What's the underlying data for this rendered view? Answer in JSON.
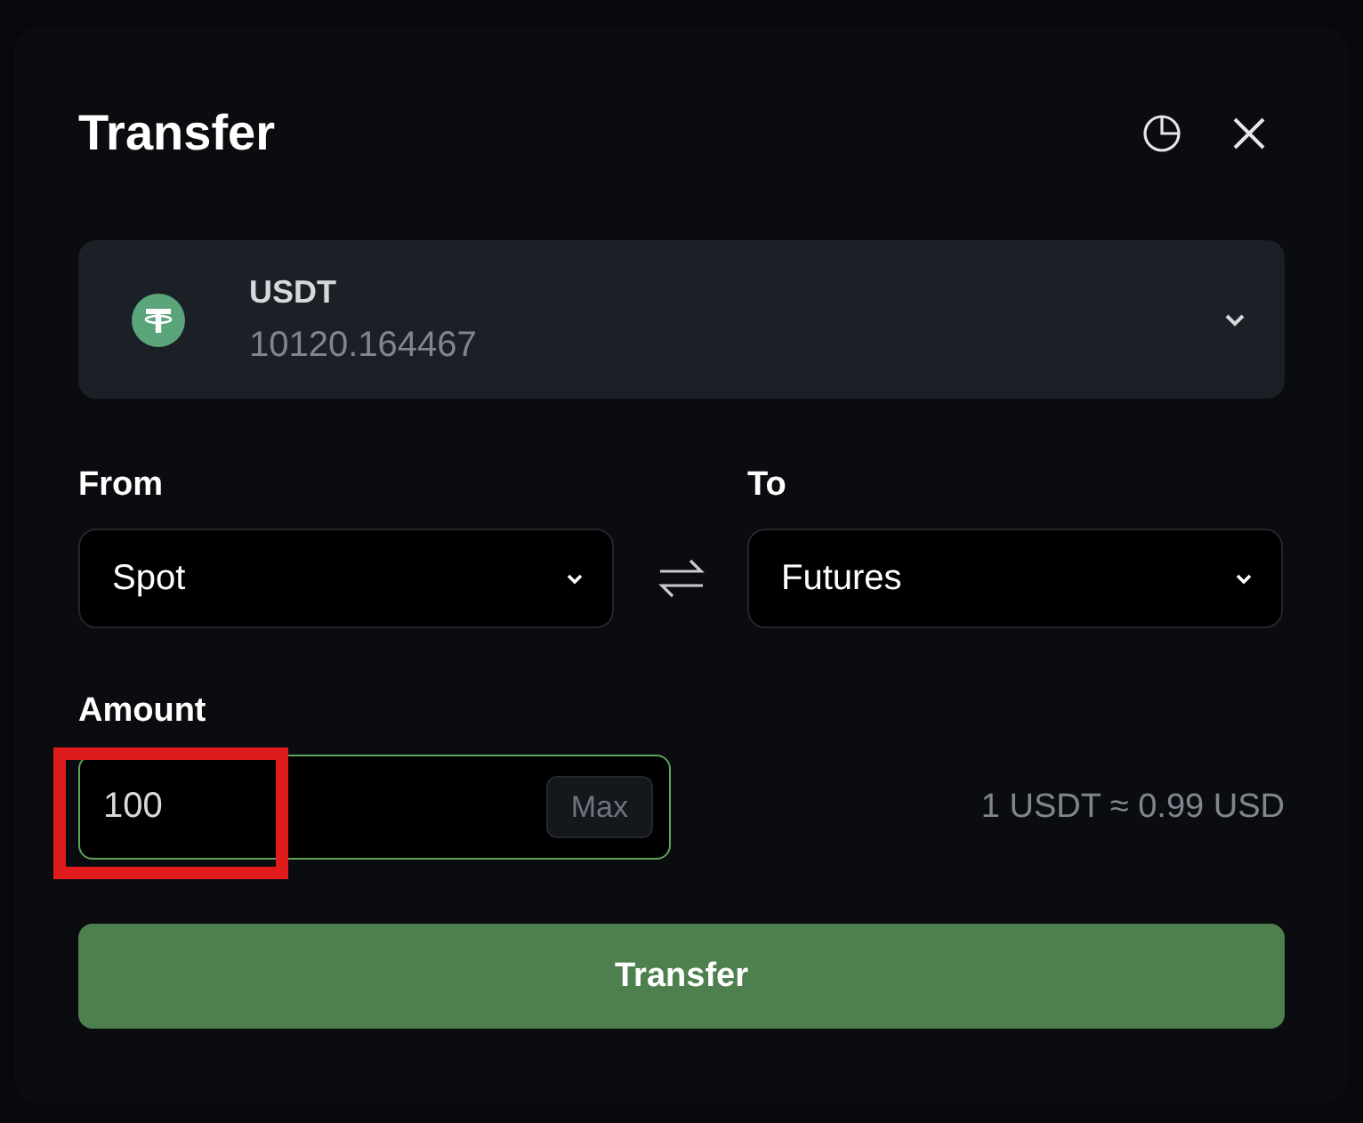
{
  "dialog": {
    "title": "Transfer"
  },
  "asset": {
    "symbol": "USDT",
    "balance": "10120.164467"
  },
  "from": {
    "label": "From",
    "value": "Spot"
  },
  "to": {
    "label": "To",
    "value": "Futures"
  },
  "amount": {
    "label": "Amount",
    "value": "100",
    "focused": true,
    "highlighted": true,
    "max_label": "Max",
    "rate": "1 USDT ≈ 0.99 USD"
  },
  "submit": {
    "label": "Transfer"
  }
}
